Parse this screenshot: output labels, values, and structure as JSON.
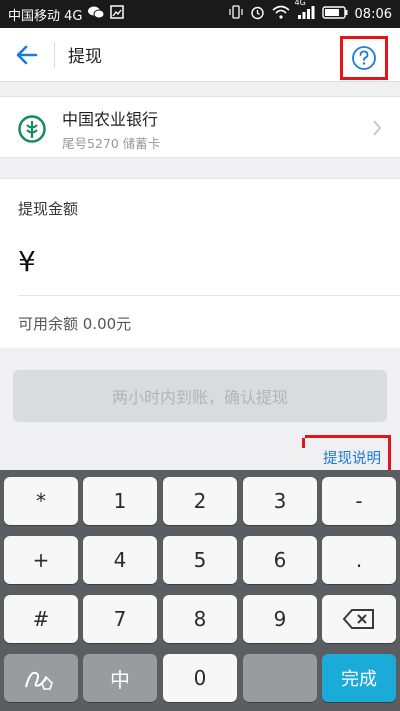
{
  "status_bar": {
    "carrier": "中国移动 4G",
    "network": "4G",
    "time": "08:06"
  },
  "header": {
    "title": "提现",
    "back_icon": "arrow-left-icon",
    "help_icon": "question-circle-icon"
  },
  "bank": {
    "name": "中国农业银行",
    "detail": "尾号5270 储蓄卡",
    "logo": "abc-bank-logo"
  },
  "amount": {
    "label": "提现金额",
    "currency": "¥",
    "value": "",
    "balance_text": "可用余额 0.00元"
  },
  "confirm_button": {
    "label": "两小时内到账，确认提现"
  },
  "explain_link": "提现说明",
  "keyboard": {
    "rows": [
      [
        "*",
        "1",
        "2",
        "3",
        "-"
      ],
      [
        "+",
        "4",
        "5",
        "6",
        "."
      ],
      [
        "#",
        "7",
        "8",
        "9",
        "⌫"
      ],
      [
        "✍",
        "中",
        "0",
        "",
        "完成"
      ]
    ],
    "done_label": "完成",
    "handwrite_label": "中"
  },
  "colors": {
    "accent": "#1a7ae0",
    "highlight_box": "#e2141c",
    "done_key": "#1aabd9",
    "bank_green": "#1a8a5a"
  }
}
